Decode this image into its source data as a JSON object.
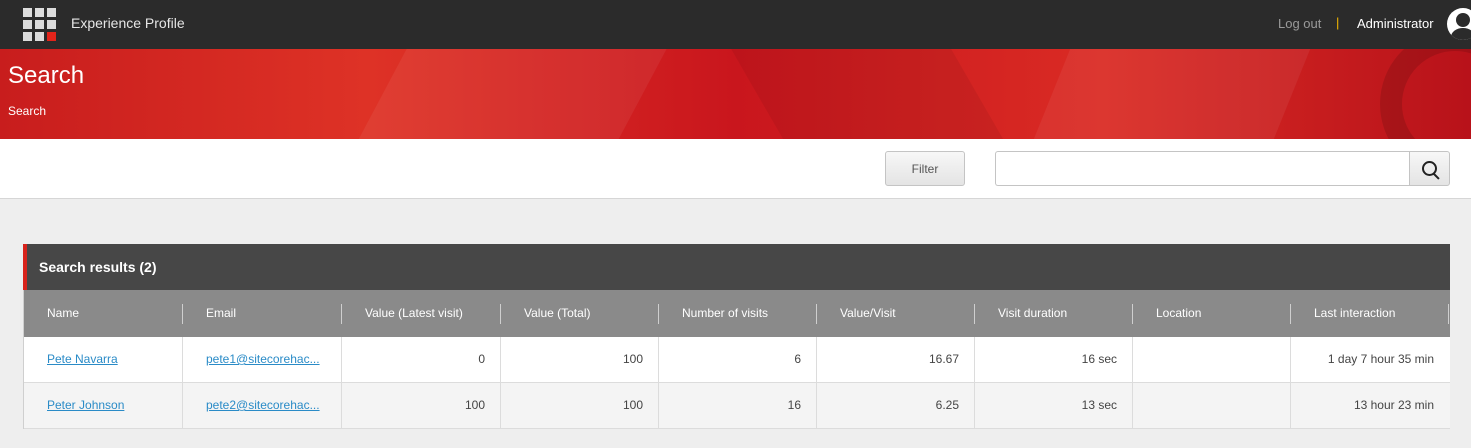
{
  "app": {
    "title": "Experience Profile"
  },
  "header": {
    "logout": "Log out",
    "separator": "|",
    "user": "Administrator"
  },
  "banner": {
    "title": "Search",
    "breadcrumb": "Search"
  },
  "toolbar": {
    "filter_label": "Filter",
    "search_value": ""
  },
  "results": {
    "title": "Search results (2)",
    "columns": [
      "Name",
      "Email",
      "Value (Latest visit)",
      "Value (Total)",
      "Number of visits",
      "Value/Visit",
      "Visit duration",
      "Location",
      "Last interaction"
    ],
    "rows": [
      {
        "name": "Pete Navarra",
        "email": "pete1@sitecorehac...",
        "latest": "0",
        "total": "100",
        "visits": "6",
        "per_visit": "16.67",
        "duration": "16 sec",
        "location": "",
        "last": "1 day 7 hour 35 min"
      },
      {
        "name": "Peter Johnson",
        "email": "pete2@sitecorehac...",
        "latest": "100",
        "total": "100",
        "visits": "16",
        "per_visit": "6.25",
        "duration": "13 sec",
        "location": "",
        "last": "13 hour 23 min"
      }
    ]
  },
  "colors": {
    "accent": "#d8231c",
    "topbar": "#2b2b2b",
    "link": "#2a8bc7"
  },
  "icons": [
    "app-grid-icon",
    "user-avatar-icon",
    "search-icon"
  ]
}
